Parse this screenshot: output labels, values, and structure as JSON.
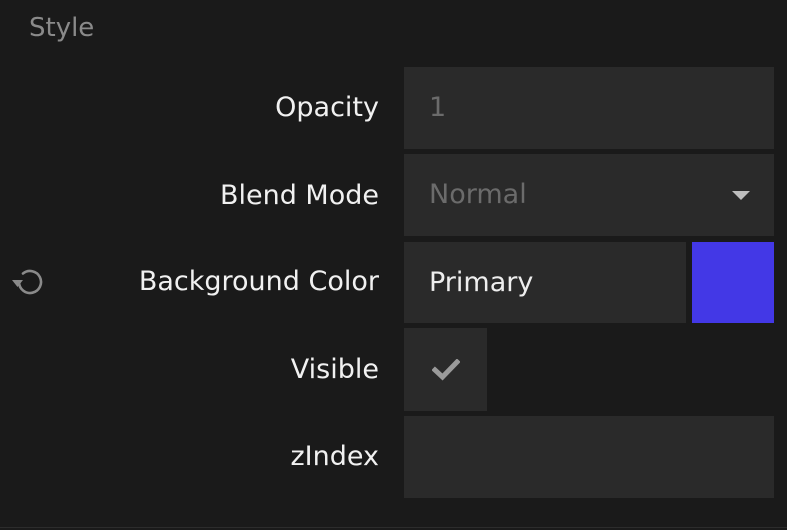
{
  "section": {
    "title": "Style"
  },
  "rows": {
    "opacity": {
      "label": "Opacity",
      "value": "1"
    },
    "blend_mode": {
      "label": "Blend Mode",
      "value": "Normal"
    },
    "background_color": {
      "label": "Background Color",
      "value": "Primary",
      "swatch_color": "#4338e6"
    },
    "visible": {
      "label": "Visible",
      "checked": true
    },
    "zindex": {
      "label": "zIndex",
      "value": ""
    }
  },
  "colors": {
    "panel_background": "#1a1a1a",
    "field_background": "#2a2a2a",
    "label_text": "#f1f1f1",
    "muted_text": "#6b6b6b",
    "accent": "#4338e6"
  },
  "icons": {
    "reset": "reset-icon",
    "dropdown": "chevron-down-icon",
    "check": "check-icon"
  }
}
